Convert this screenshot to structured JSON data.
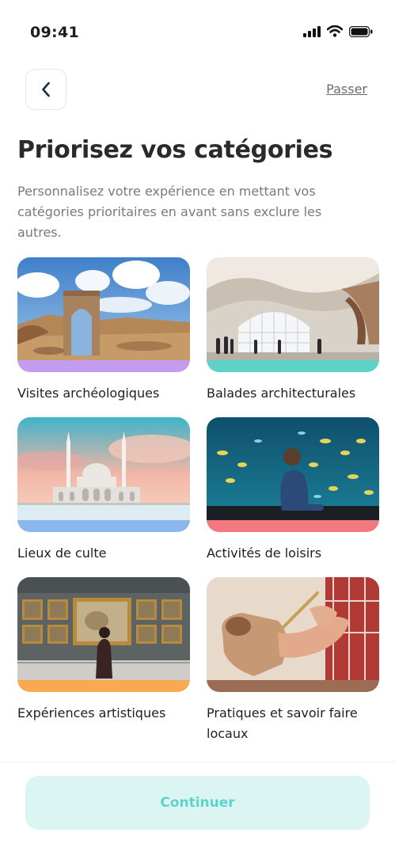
{
  "status_bar": {
    "time": "09:41"
  },
  "header": {
    "skip_label": "Passer"
  },
  "title": "Priorisez vos catégories",
  "subtitle": "Personnalisez votre expérience en mettant vos catégories prioritaires en avant sans exclure les autres.",
  "categories": [
    {
      "label": "Visites archéologiques",
      "band_color": "#c39cf0"
    },
    {
      "label": "Balades architecturales",
      "band_color": "#5cd3c6"
    },
    {
      "label": "Lieux de culte",
      "band_color": "#8ab7ec"
    },
    {
      "label": "Activités de loisirs",
      "band_color": "#f3787f"
    },
    {
      "label": "Expériences artistiques",
      "band_color": "#f9a951"
    },
    {
      "label": "Pratiques et savoir faire locaux",
      "band_color": "#9b6d55"
    }
  ],
  "footer": {
    "continue_label": "Continuer"
  },
  "colors": {
    "accent": "#5fd3c9",
    "button_bg": "#dbf5f3"
  }
}
